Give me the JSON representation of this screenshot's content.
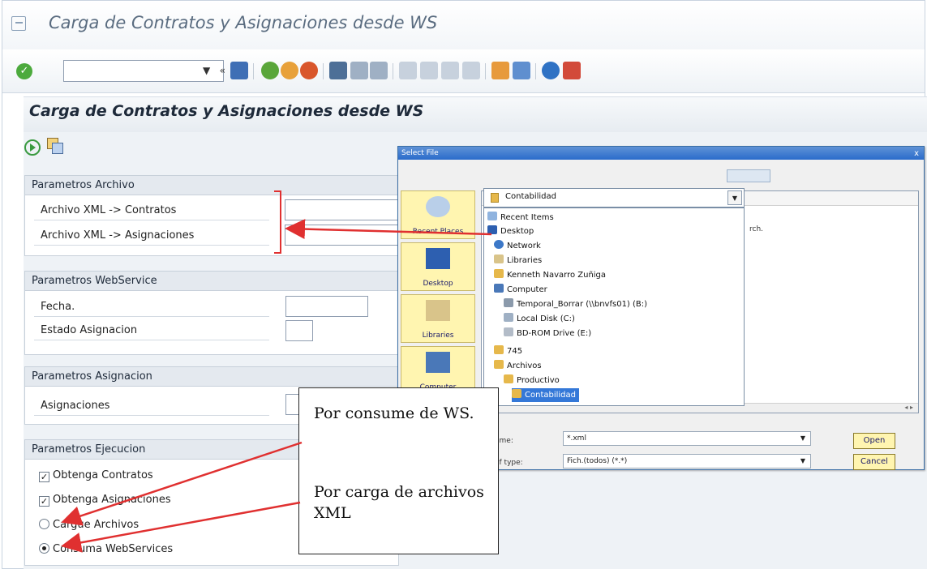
{
  "window": {
    "title": "Carga de Contratos y Asignaciones desde WS"
  },
  "toolbar": {
    "ok_icon": "checkmark-icon",
    "command_field": "",
    "colors": {
      "ok": "#4caa3d",
      "accent": "#2a6bcb"
    }
  },
  "screen": {
    "title": "Carga de Contratos y Asignaciones desde WS"
  },
  "groups": {
    "archivo": {
      "title": "Parametros Archivo",
      "fields": [
        {
          "label": "Archivo XML -> Contratos",
          "value": ""
        },
        {
          "label": "Archivo XML -> Asignaciones",
          "value": ""
        }
      ]
    },
    "webservice": {
      "title": "Parametros WebService",
      "fields": [
        {
          "label": "Fecha.",
          "value": ""
        },
        {
          "label": "Estado Asignacion",
          "value": ""
        }
      ]
    },
    "asignacion": {
      "title": "Parametros Asignacion",
      "fields": [
        {
          "label": "Asignaciones",
          "value": ""
        }
      ]
    },
    "ejecucion": {
      "title": "Parametros Ejecucion",
      "checkboxes": [
        {
          "label": "Obtenga Contratos",
          "checked": true
        },
        {
          "label": "Obtenga Asignaciones",
          "checked": true
        }
      ],
      "radios": [
        {
          "label": "Cargue Archivos",
          "selected": false
        },
        {
          "label": "Consuma WebServices",
          "selected": true
        }
      ]
    }
  },
  "dialog": {
    "title": "Select File",
    "close": "x",
    "look_in": "Contabilidad",
    "places": [
      "Recent Places",
      "Desktop",
      "Libraries",
      "Computer"
    ],
    "dropdown_items": [
      "Recent Items",
      "Desktop",
      "Network",
      "Libraries",
      "Kenneth Navarro Zuñiga",
      "Computer",
      "Temporal_Borrar (\\\\bnvfs01) (B:)",
      "Local Disk (C:)",
      "BD-ROM Drive (E:)",
      "745",
      "Archivos",
      "Productivo",
      "Contabilidad"
    ],
    "pane_text": "rch.",
    "file_name_label": "ame:",
    "file_name_value": "*.xml",
    "file_type_label": "of type:",
    "file_type_value": "Fich.(todos) (*.*)",
    "open_label": "Open",
    "cancel_label": "Cancel"
  },
  "callout": {
    "text1": "Por consume de WS.",
    "text2": "Por carga de archivos XML"
  }
}
